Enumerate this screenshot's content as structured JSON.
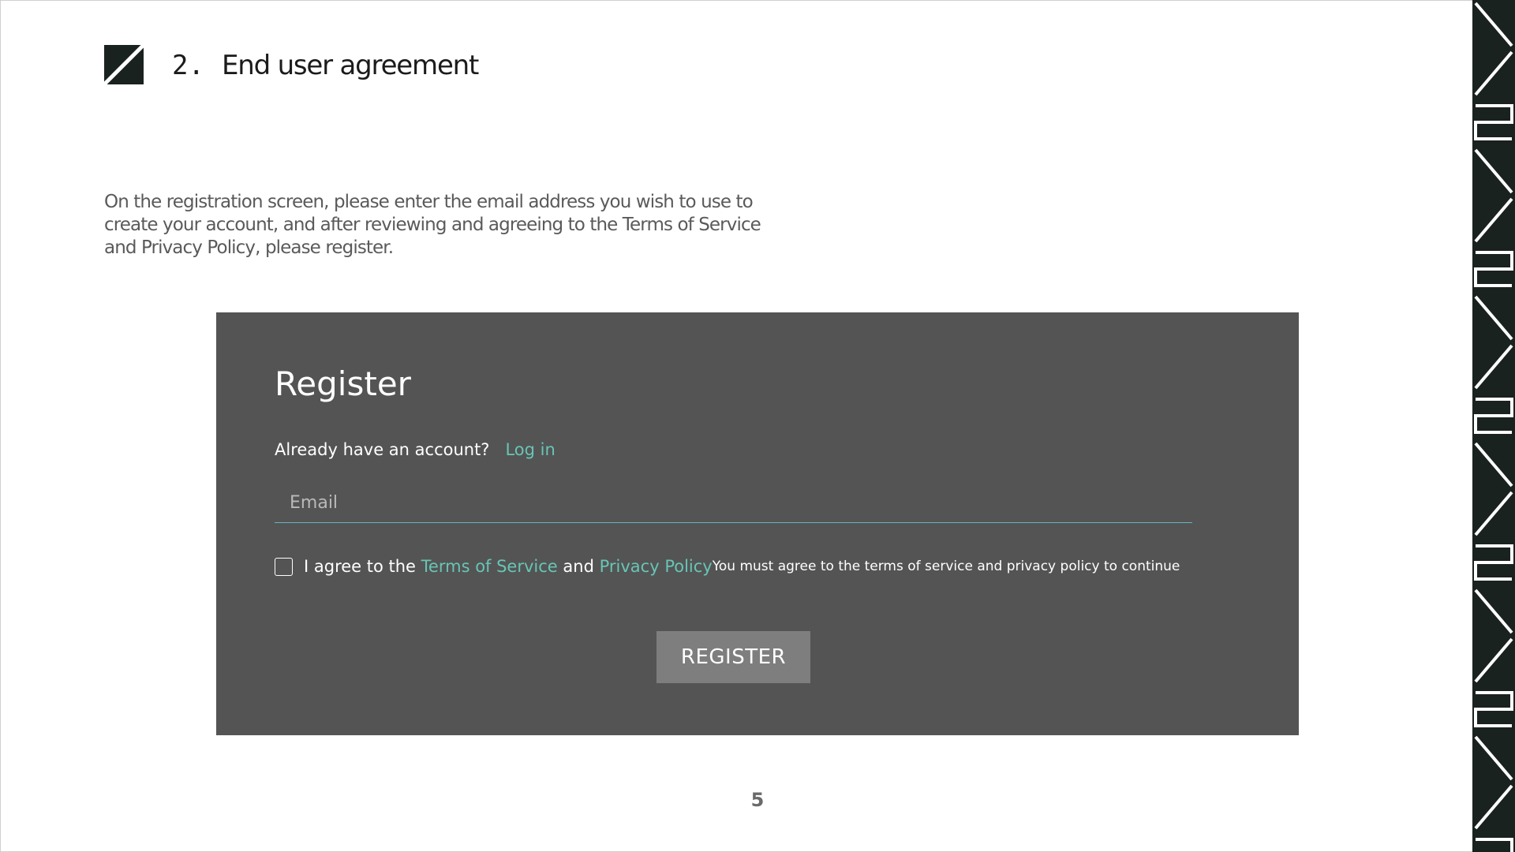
{
  "heading": {
    "number": "2.",
    "title": "End user agreement",
    "logo_icon": "diagonal-split-square-icon"
  },
  "intro": {
    "lines": [
      "On the registration screen, please enter the email address you wish to use to",
      "create your account, and after reviewing and agreeing to the Terms of Service",
      "and Privacy Policy, please register."
    ]
  },
  "form": {
    "title": "Register",
    "already_have_account": "Already have an account?",
    "login_link": "Log in",
    "email_placeholder": "Email",
    "email_value": "",
    "agree_prefix": "I agree to the",
    "terms_link": "Terms of Service",
    "and_text": "and",
    "privacy_link": "Privacy Policy",
    "agree_note": "You must agree to the terms of service and privacy policy to continue",
    "checkbox_checked": false,
    "register_button": "REGISTER"
  },
  "footer": {
    "page_number": "5"
  },
  "colors": {
    "panel_bg": "#545454",
    "accent_link": "#67c5b6",
    "button_bg": "#7e7e7e",
    "pattern_dark": "#1a221f"
  }
}
